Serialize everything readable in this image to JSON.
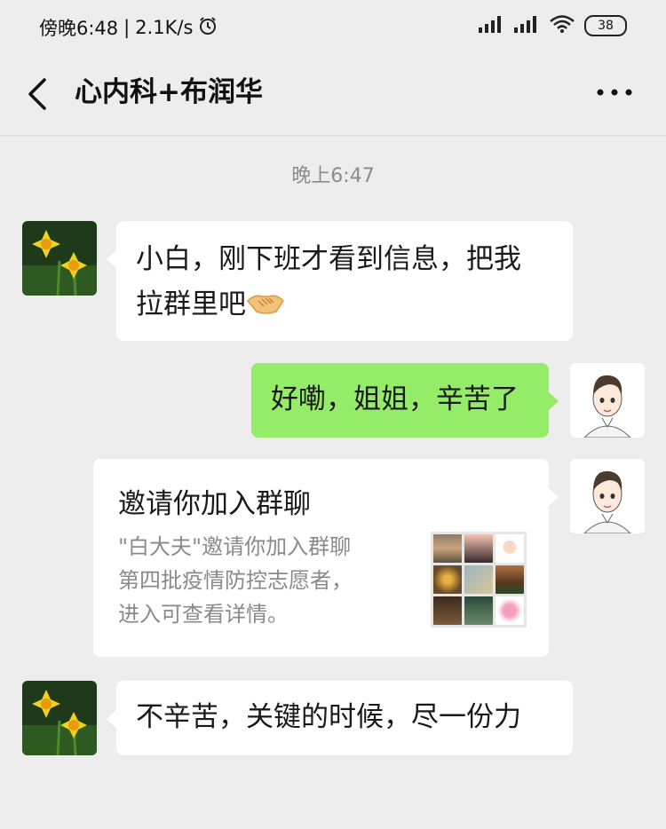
{
  "status_bar": {
    "time": "傍晚6:48",
    "speed": "2.1K/s",
    "battery": "38"
  },
  "nav": {
    "title": "心内科+布润华"
  },
  "chat": {
    "timestamp": "晚上6:47",
    "messages": [
      {
        "sender": "contact",
        "lines": [
          "小白，刚下班才看到信息，把我",
          "拉群里吧"
        ],
        "emoji": "handshake"
      },
      {
        "sender": "me",
        "text": "好嘞，姐姐，辛苦了"
      },
      {
        "sender": "me",
        "type": "invite-card",
        "title": "邀请你加入群聊",
        "desc_lines": [
          "\"白大夫\"邀请你加入群聊",
          "第四批疫情防控志愿者，",
          "进入可查看详情。"
        ]
      },
      {
        "sender": "contact",
        "text": "不辛苦，关键的时候，尽一份力"
      }
    ]
  },
  "colors": {
    "background": "#ededed",
    "bubble_me": "#95ec69",
    "bubble_contact": "#ffffff"
  }
}
